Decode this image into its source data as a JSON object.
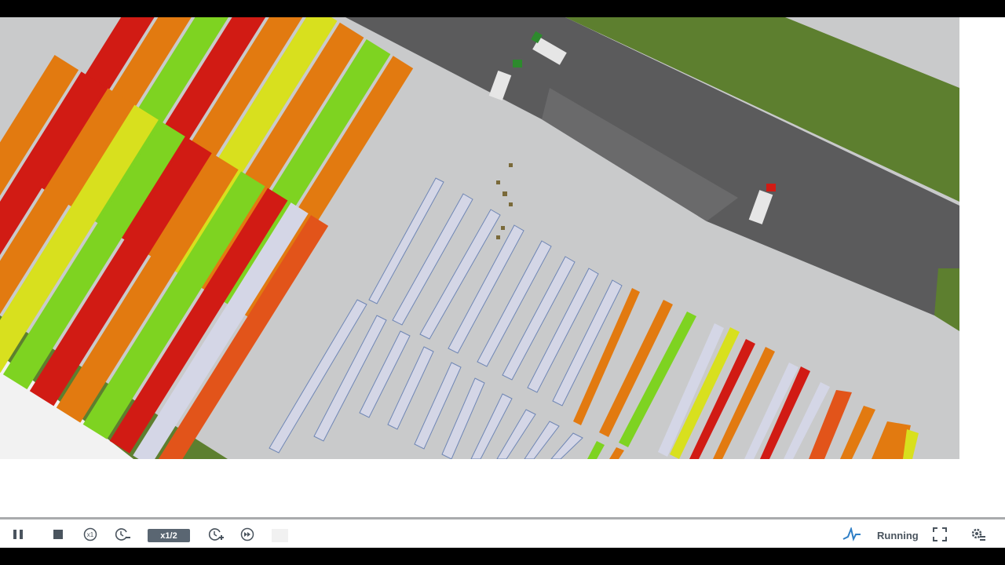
{
  "toolbar": {
    "speed_label": "x1/2",
    "status_label": "Running",
    "icons": [
      "pause-icon",
      "stop-icon",
      "run-x1-icon",
      "slow-down-icon",
      "speed-up-icon",
      "fast-forward-icon",
      "chart-icon",
      "fullscreen-icon",
      "settings-icon"
    ]
  },
  "viewport": {
    "description_colors": {
      "ground": "#c9cacb",
      "road": "#5a5a5b",
      "grass": "#5d7f2f",
      "rack_empty": "#d4d6e6",
      "rack_red": "#d11b14",
      "rack_orange": "#e27a10",
      "rack_yellow": "#d8e01e",
      "rack_green": "#7ed321"
    }
  }
}
